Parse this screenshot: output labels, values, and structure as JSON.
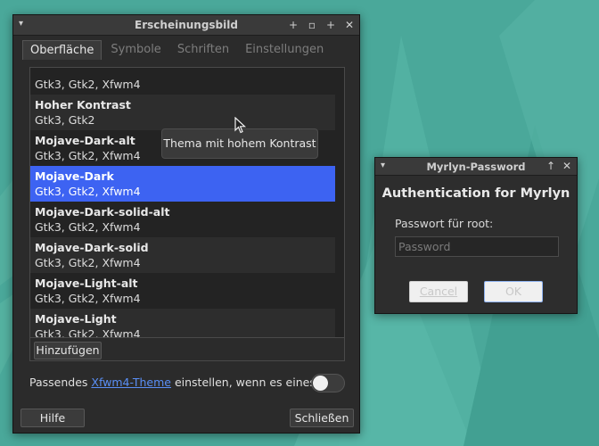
{
  "appearance": {
    "title": "Erscheinungsbild",
    "menu_icon": "chevron-down-icon",
    "tabs": [
      {
        "label": "Oberfläche"
      },
      {
        "label": "Symbole"
      },
      {
        "label": "Schriften"
      },
      {
        "label": "Einstellungen"
      }
    ],
    "partial_item": {
      "desc": "Gtk3, Gtk2, Xfwm4"
    },
    "themes": [
      {
        "name": "Hoher Kontrast",
        "desc": "Gtk3, Gtk2"
      },
      {
        "name": "Mojave-Dark-alt",
        "desc": "Gtk3, Gtk2, Xfwm4"
      },
      {
        "name": "Mojave-Dark",
        "desc": "Gtk3, Gtk2, Xfwm4"
      },
      {
        "name": "Mojave-Dark-solid-alt",
        "desc": "Gtk3, Gtk2, Xfwm4"
      },
      {
        "name": "Mojave-Dark-solid",
        "desc": "Gtk3, Gtk2, Xfwm4"
      },
      {
        "name": "Mojave-Light-alt",
        "desc": "Gtk3, Gtk2, Xfwm4"
      },
      {
        "name": "Mojave-Light",
        "desc": "Gtk3, Gtk2, Xfwm4"
      }
    ],
    "selected_theme": "Mojave-Dark",
    "tooltip": "Thema mit hohem Kontrast",
    "add_button": "Hinzufügen",
    "theme_row": {
      "prefix": "Passendes ",
      "link": "Xfwm4-Theme",
      "suffix": " einstellen, wenn es eines gibt"
    },
    "help_button": "Hilfe",
    "close_button": "Schließen"
  },
  "password_dialog": {
    "title": "Myrlyn-Password",
    "heading": "Authentication for Myrlyn",
    "label": "Passwort für root:",
    "placeholder": "Password",
    "cancel": "Cancel",
    "ok": "OK"
  },
  "colors": {
    "desktop": "#4aa89a",
    "selection": "#3d63f2",
    "link": "#5a8ff6"
  }
}
